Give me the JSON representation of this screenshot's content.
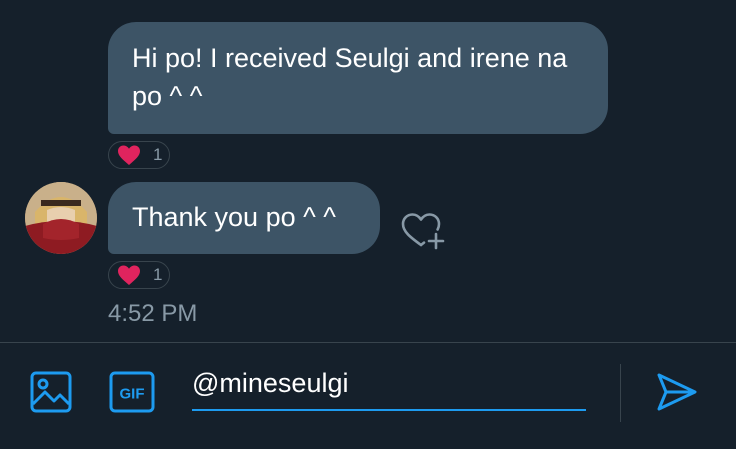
{
  "messages": [
    {
      "text": "Hi po! I received Seulgi and irene na po ^ ^",
      "reaction": {
        "icon": "heart-icon",
        "count": "1"
      }
    },
    {
      "text": "Thank you po ^ ^",
      "reaction": {
        "icon": "heart-icon",
        "count": "1"
      }
    }
  ],
  "timestamp": "4:52 PM",
  "compose": {
    "value": "@mineseulgi",
    "image_icon": "image-icon",
    "gif_label": "GIF",
    "send_icon": "send-icon"
  },
  "colors": {
    "background": "#15202b",
    "bubble": "#3d5466",
    "accent": "#1d9bf0",
    "heart": "#f91880",
    "muted": "#8899a6"
  }
}
